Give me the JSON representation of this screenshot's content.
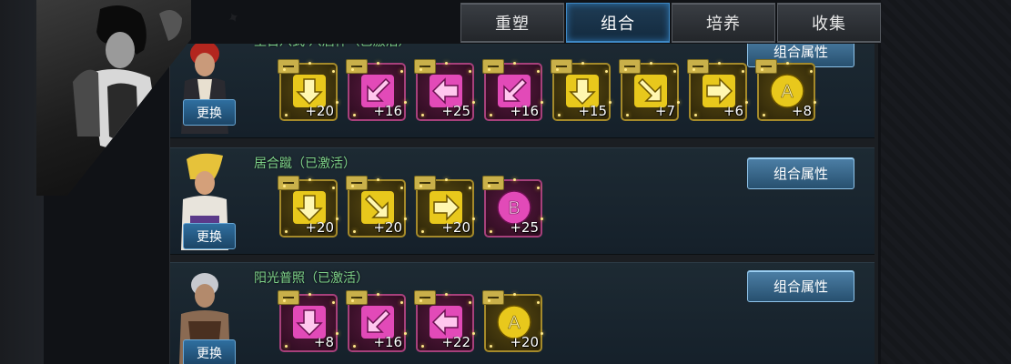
{
  "tabs": [
    {
      "label": "重塑",
      "active": false
    },
    {
      "label": "组合",
      "active": true
    },
    {
      "label": "培养",
      "active": false
    },
    {
      "label": "收集",
      "active": false
    }
  ],
  "colors": {
    "yellow": "#e6c61a",
    "pink": "#d93ab0",
    "accent": "#3e88c4",
    "combo_name": "#7fd38a"
  },
  "swap_label": "更换",
  "attr_label": "组合属性",
  "combos": [
    {
      "name": "里百八式·八酒杯（已激活）",
      "character": "iori",
      "moves": [
        {
          "color": "yellow",
          "icon": "arrow-down",
          "value": "+20"
        },
        {
          "color": "pink",
          "icon": "arrow-down-left",
          "value": "+16"
        },
        {
          "color": "pink",
          "icon": "arrow-left",
          "value": "+25"
        },
        {
          "color": "pink",
          "icon": "arrow-down-left",
          "value": "+16"
        },
        {
          "color": "yellow",
          "icon": "arrow-down",
          "value": "+15"
        },
        {
          "color": "yellow",
          "icon": "arrow-down-right",
          "value": "+7"
        },
        {
          "color": "yellow",
          "icon": "arrow-right",
          "value": "+6"
        },
        {
          "color": "yellow",
          "icon": "button-a",
          "value": "+8"
        }
      ]
    },
    {
      "name": "居合蹴（已激活）",
      "character": "andy",
      "moves": [
        {
          "color": "yellow",
          "icon": "arrow-down",
          "value": "+20"
        },
        {
          "color": "yellow",
          "icon": "arrow-down-right",
          "value": "+20"
        },
        {
          "color": "yellow",
          "icon": "arrow-right",
          "value": "+20"
        },
        {
          "color": "pink",
          "icon": "button-b",
          "value": "+25"
        }
      ]
    },
    {
      "name": "阳光普照（已激活）",
      "character": "k9999",
      "moves": [
        {
          "color": "pink",
          "icon": "arrow-down",
          "value": "+8"
        },
        {
          "color": "pink",
          "icon": "arrow-down-left",
          "value": "+16"
        },
        {
          "color": "pink",
          "icon": "arrow-left",
          "value": "+22"
        },
        {
          "color": "yellow",
          "icon": "button-a",
          "value": "+20"
        }
      ]
    }
  ]
}
